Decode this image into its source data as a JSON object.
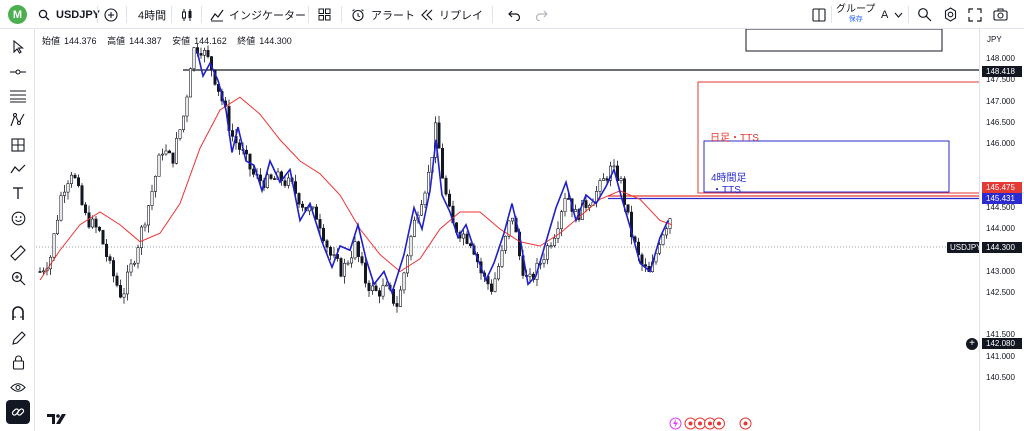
{
  "toolbar": {
    "avatar_letter": "M",
    "symbol": "USDJPY",
    "interval": "4時間",
    "indicators_label": "インジケーター",
    "alert_label": "アラート",
    "replay_label": "リプレイ",
    "layout_name": "グループ",
    "layout_sub": "保存",
    "layout_letter": "A"
  },
  "ohlc": {
    "open_label": "始値",
    "open": "144.376",
    "high_label": "高値",
    "high": "144.387",
    "low_label": "安値",
    "low": "144.162",
    "close_label": "終値",
    "close": "144.300"
  },
  "axis": {
    "currency": "JPY",
    "ticks": [
      "148.000",
      "147.500",
      "147.000",
      "146.500",
      "146.000",
      "145.000",
      "144.500",
      "144.000",
      "143.500",
      "143.000",
      "142.500",
      "141.500",
      "141.000",
      "140.500"
    ],
    "labels": {
      "level_148": "148.418",
      "red_level": "145.475",
      "blue_level": "145.431",
      "current": "144.300",
      "level_142": "142.080"
    }
  },
  "chart": {
    "symbol_tag": "USDJPY",
    "red_box_label": "日足・TTS",
    "blue_box_label_line1": "4時間足",
    "blue_box_label_line2": "・TTS",
    "colors": {
      "candle": "#131722",
      "blue_line": "#1f1fcc",
      "ma": "#ee3333",
      "red_box": "#e53935",
      "blue_box": "#2b2bd1"
    }
  }
}
